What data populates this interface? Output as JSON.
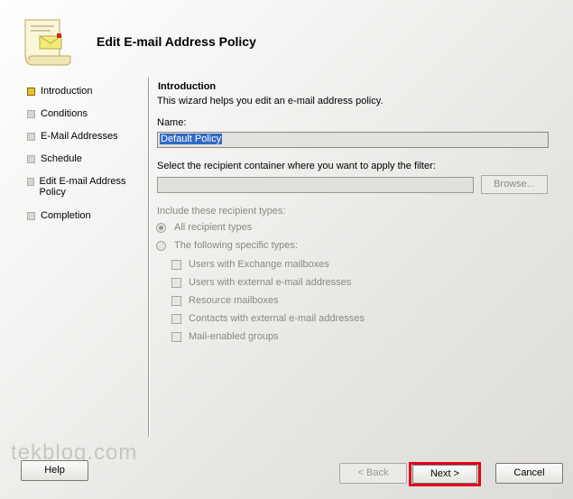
{
  "header": {
    "title": "Edit E-mail Address Policy",
    "icon": "wizard-scroll-icon"
  },
  "steps": [
    {
      "label": "Introduction",
      "state": "current"
    },
    {
      "label": "Conditions",
      "state": "pending"
    },
    {
      "label": "E-Mail Addresses",
      "state": "pending"
    },
    {
      "label": "Schedule",
      "state": "pending"
    },
    {
      "label": "Edit E-mail Address Policy",
      "state": "pending"
    },
    {
      "label": "Completion",
      "state": "pending"
    }
  ],
  "main": {
    "section_title": "Introduction",
    "description": "This wizard helps you edit an e-mail address policy.",
    "name_label": "Name:",
    "name_value": "Default Policy",
    "container_label": "Select the recipient container where you want to apply the filter:",
    "container_value": "",
    "browse_label": "Browse...",
    "types_label": "Include these recipient types:",
    "radio_all": "All recipient types",
    "radio_specific": "The following specific types:",
    "checkboxes": [
      "Users with Exchange mailboxes",
      "Users with external e-mail addresses",
      "Resource mailboxes",
      "Contacts with external e-mail addresses",
      "Mail-enabled groups"
    ]
  },
  "footer": {
    "help_label": "Help",
    "back_label": "< Back",
    "next_label": "Next >",
    "cancel_label": "Cancel",
    "highlight_color": "#e0001a"
  },
  "watermark": "tekblog.com"
}
